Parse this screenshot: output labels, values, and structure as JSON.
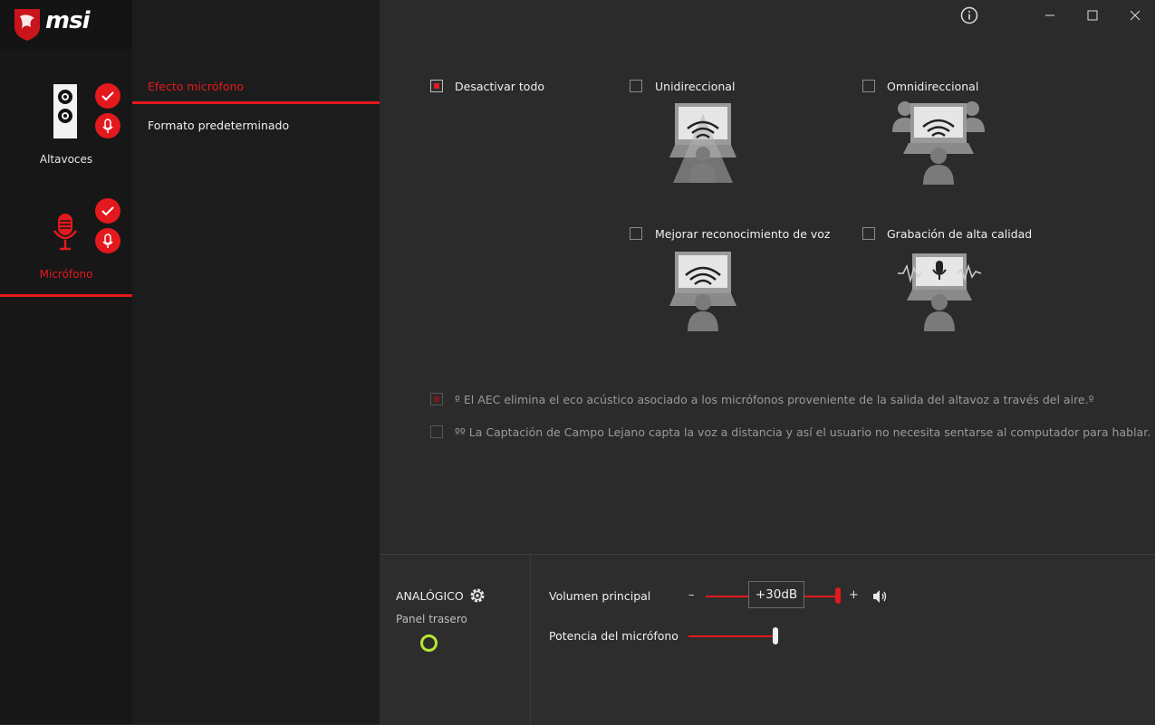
{
  "brand": "msi",
  "window": {
    "info_icon": "info-icon",
    "minimize_icon": "minimize-icon",
    "maximize_icon": "maximize-icon",
    "close_icon": "close-icon"
  },
  "devices": [
    {
      "label": "Altavoces",
      "icon": "speaker-icon",
      "active": false
    },
    {
      "label": "Micrófono",
      "icon": "microphone-icon",
      "active": true
    }
  ],
  "submenu": [
    {
      "label": "Efecto micrófono",
      "active": true
    },
    {
      "label": "Formato predeterminado",
      "active": false
    }
  ],
  "effects": {
    "disable_all": {
      "label": "Desactivar todo",
      "checked": true
    },
    "unidirectional": {
      "label": "Unidireccional",
      "checked": false
    },
    "omnidirectional": {
      "label": "Omnidireccional",
      "checked": false
    },
    "voice_recognition": {
      "label": "Mejorar reconocimiento de voz",
      "checked": false
    },
    "hq_recording": {
      "label": "Grabación de alta calidad",
      "checked": false
    }
  },
  "notes": {
    "aec": {
      "text": "º El AEC elimina el eco acústico asociado a los micrófonos proveniente de la salida del altavoz a través del aire.º",
      "checked": true
    },
    "far_field": {
      "text": "ºº La Captación de Campo Lejano capta la voz a distancia y así el usuario no necesita sentarse al computador para hablar.",
      "checked": false
    }
  },
  "analog": {
    "title": "ANALÓGICO",
    "subtitle": "Panel trasero",
    "gear_icon": "gear-icon",
    "jack_color": "#b8e830"
  },
  "volume": {
    "label": "Volumen principal",
    "minus": "–",
    "plus": "+",
    "value_label": "+30dB",
    "level": 1.0
  },
  "mic_boost": {
    "label": "Potencia del micrófono",
    "level": 1.0
  },
  "colors": {
    "accent": "#e3191e",
    "bg": "#2b2b2b",
    "sidebar": "#171717"
  }
}
